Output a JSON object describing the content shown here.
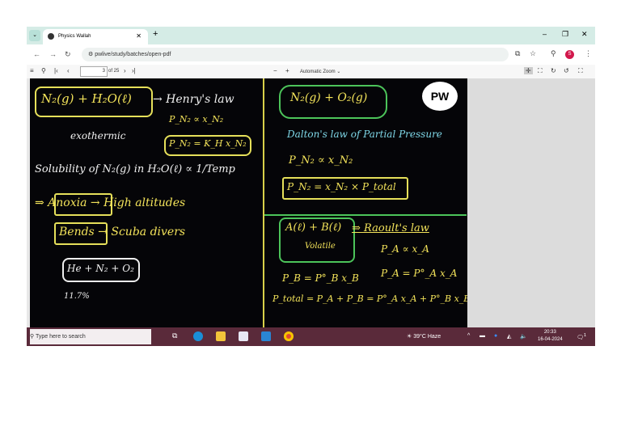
{
  "browser": {
    "tab_title": "Physics Wallah",
    "url": "pwlive/study/batches/open-pdf",
    "profile_initial": "S"
  },
  "pdf_toolbar": {
    "page_current": "3",
    "page_total": "of 25",
    "zoom": "Automatic Zoom ⌄"
  },
  "board": {
    "logo": "PW",
    "left": [
      "N₂(g) + H₂O(ℓ)",
      "→ Henry's law",
      "exothermic",
      "P_N₂ ∝ x_N₂",
      "P_N₂ = K_H x_N₂",
      "Solubility of N₂(g) in H₂O(ℓ) ∝ 1/Temp",
      "⇒ Anoxia → High altitudes",
      "Bends → Scuba divers",
      "He + N₂ + O₂",
      "11.7%"
    ],
    "right": [
      "N₂(g) + O₂(g)",
      "Dalton's law of Partial Pressure",
      "P_N₂ ∝ x_N₂",
      "P_N₂ = x_N₂ × P_total",
      "A(ℓ) + B(ℓ)",
      "Volatile",
      "⇒ Raoult's law",
      "P_A ∝ x_A",
      "P_A = P°_A x_A",
      "P_B = P°_B x_B",
      "P_total = P_A + P_B = P°_A x_A + P°_B x_B"
    ]
  },
  "taskbar": {
    "search_placeholder": "Type here to search",
    "weather": "39°C Haze",
    "time": "20:33",
    "date": "16-04-2024",
    "notifications": "1"
  }
}
